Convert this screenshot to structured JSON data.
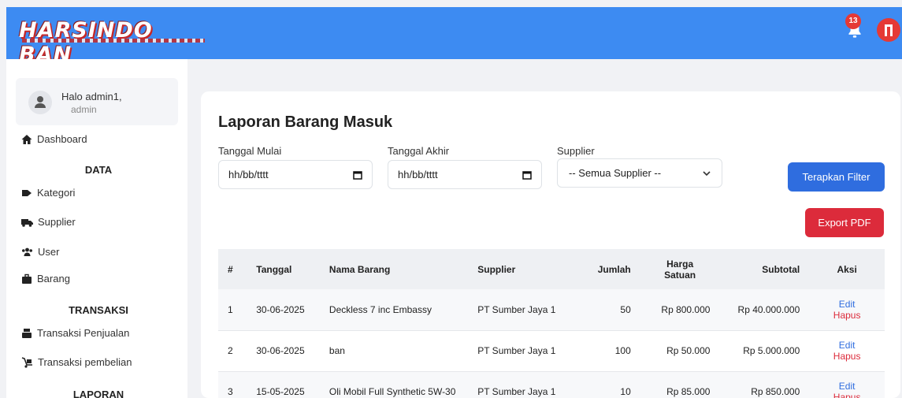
{
  "brand": {
    "logo_text": "HARSINDO BAN",
    "accent": "#3d8bf2"
  },
  "header": {
    "notification_count": "13"
  },
  "sidebar": {
    "greeting": "Halo admin1,",
    "role": "admin",
    "dashboard": "Dashboard",
    "section_data": "DATA",
    "data_items": [
      "Kategori",
      "Supplier",
      "User",
      "Barang"
    ],
    "section_transaksi": "TRANSAKSI",
    "transaksi_items": [
      "Transaksi Penjualan",
      "Transaksi pembelian"
    ],
    "section_laporan": "LAPORAN"
  },
  "page": {
    "title": "Laporan Barang Masuk",
    "filter": {
      "start_label": "Tanggal Mulai",
      "start_value": "hh/bb/tttt",
      "end_label": "Tanggal Akhir",
      "end_value": "hh/bb/tttt",
      "supplier_label": "Supplier",
      "supplier_value": "-- Semua Supplier --",
      "apply_button": "Terapkan Filter"
    },
    "export_button": "Export PDF",
    "table": {
      "headers": [
        "#",
        "Tanggal",
        "Nama Barang",
        "Supplier",
        "Jumlah",
        "Harga Satuan",
        "Subtotal",
        "Aksi"
      ],
      "edit_label": "Edit",
      "delete_label": "Hapus",
      "rows": [
        {
          "no": "1",
          "tanggal": "30-06-2025",
          "nama": "Deckless 7 inc Embassy",
          "supplier": "PT Sumber Jaya 1",
          "jumlah": "50",
          "harga": "Rp 800.000",
          "subtotal": "Rp 40.000.000"
        },
        {
          "no": "2",
          "tanggal": "30-06-2025",
          "nama": "ban",
          "supplier": "PT Sumber Jaya 1",
          "jumlah": "100",
          "harga": "Rp 50.000",
          "subtotal": "Rp 5.000.000"
        },
        {
          "no": "3",
          "tanggal": "15-05-2025",
          "nama": "Oli Mobil Full Synthetic 5W-30",
          "supplier": "PT Sumber Jaya 1",
          "jumlah": "10",
          "harga": "Rp 85.000",
          "subtotal": "Rp 850.000"
        }
      ]
    }
  }
}
